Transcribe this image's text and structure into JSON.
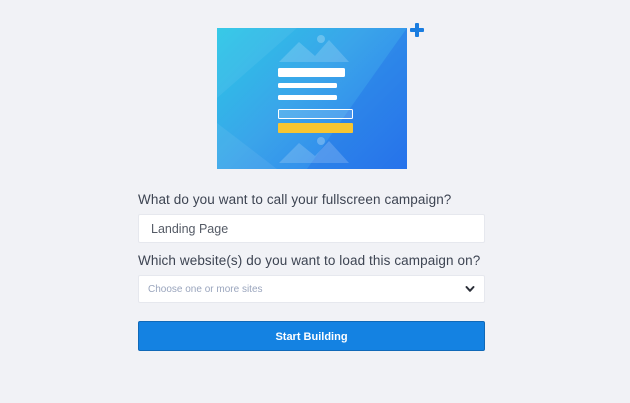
{
  "hero": {
    "icon": "fullscreen-campaign-illustration",
    "add_icon": "plus-icon",
    "colors": {
      "gradient_start": "#2bc7e6",
      "gradient_end": "#2a77ee",
      "cta_bar": "#f7c531",
      "plus": "#1a7de0"
    }
  },
  "form": {
    "name_question": "What do you want to call your fullscreen campaign?",
    "name_value": "Landing Page",
    "sites_question": "Which website(s) do you want to load this campaign on?",
    "sites_placeholder": "Choose one or more sites",
    "sites_icon": "chevron-down-icon",
    "submit_label": "Start Building",
    "submit_color": "#1482e2"
  }
}
